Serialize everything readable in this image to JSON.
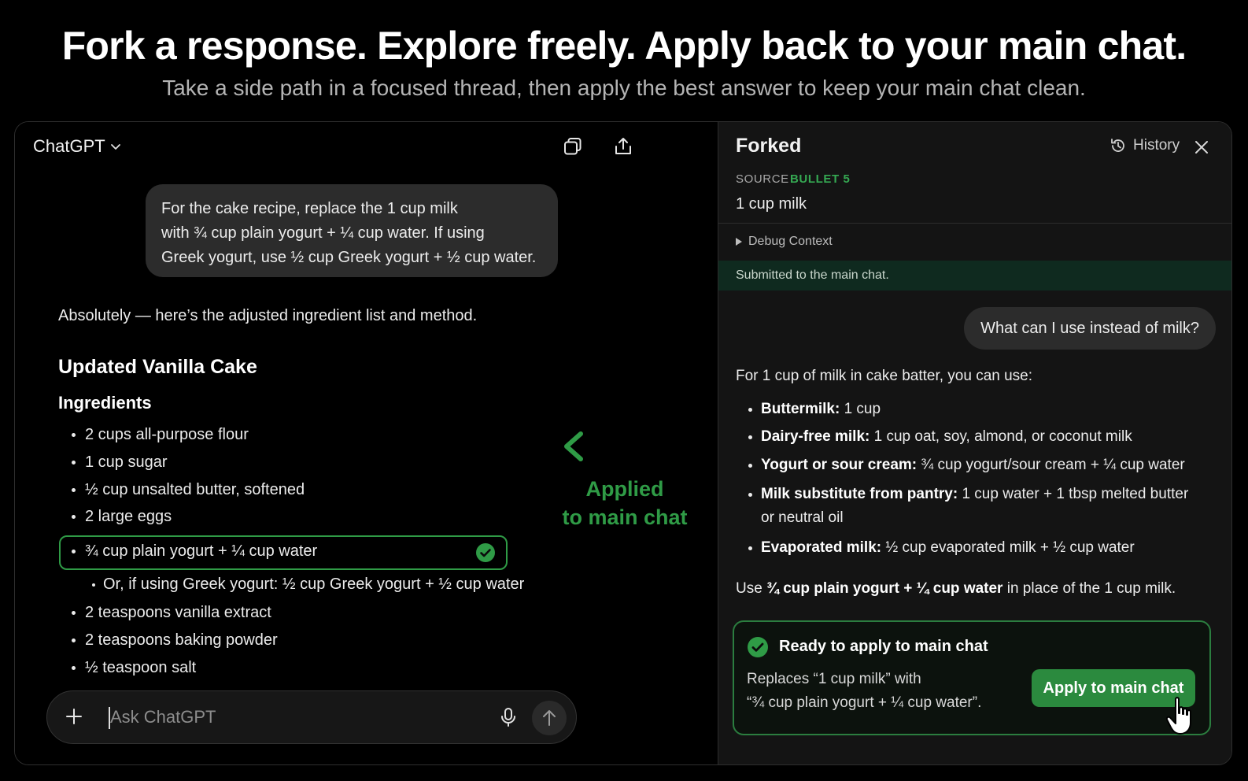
{
  "hero": {
    "title": "Fork a response. Explore freely.  Apply back to your main chat.",
    "subtitle": "Take a side path in a focused thread, then apply the best answer to keep your main chat clean."
  },
  "main_chat": {
    "model_name": "ChatGPT",
    "icons": [
      "copy-icon",
      "share-icon",
      "chevron-down-icon"
    ],
    "user_message": "For the cake recipe, replace the 1 cup milk with ¾ cup plain yogurt + ¼ cup water. If using Greek yogurt, use ½ cup Greek yogurt + ½ cup water.",
    "user_message_lines": [
      "For the cake recipe, replace the 1 cup milk",
      "with ¾ cup plain yogurt + ¼ cup water. If using",
      "Greek yogurt, use ½ cup Greek yogurt + ½ cup water."
    ],
    "assistant_intro": "Absolutely — here’s the adjusted ingredient list and method.",
    "recipe_title": "Updated Vanilla Cake",
    "ingredients_heading": "Ingredients",
    "ingredients": [
      "2 cups all-purpose flour",
      "1 cup sugar",
      "½ cup unsalted butter, softened",
      "2 large eggs",
      "¾ cup plain yogurt + ¼ cup water",
      "Or, if using Greek yogurt: ½ cup Greek yogurt + ½ cup water",
      "2 teaspoons vanilla extract",
      "2 teaspoons baking powder",
      "½ teaspoon salt"
    ],
    "highlighted_ingredient_index": 4,
    "applied_label_line1": "Applied",
    "applied_label_line2": "to main chat",
    "composer_placeholder": "Ask ChatGPT",
    "accent_green": "#2f9b46"
  },
  "fork_panel": {
    "title": "Forked",
    "history_label": "History",
    "source_label": "SOURCE",
    "source_tag": "BULLET 5",
    "source_value": "1 cup milk",
    "debug_label": "Debug Context",
    "submitted_notice": "Submitted to the main chat.",
    "question": "What can I use instead of milk?",
    "answer_lead": "For 1 cup of milk in cake batter, you can use:",
    "options": [
      {
        "name": "Buttermilk:",
        "detail": " 1 cup"
      },
      {
        "name": "Dairy-free milk:",
        "detail": " 1 cup oat, soy, almond, or coconut milk"
      },
      {
        "name": "Yogurt or sour cream:",
        "detail": " ¾ cup yogurt/sour cream + ¼ cup water"
      },
      {
        "name": "Milk substitute from pantry:",
        "detail": " 1 cup water + 1 tbsp melted butter or neutral oil"
      },
      {
        "name": "Evaporated milk:",
        "detail": " ½ cup evaporated milk + ½ cup water"
      }
    ],
    "use_prefix": "Use ",
    "use_bold": "¾ cup plain yogurt + ¼ cup water",
    "use_suffix": " in place of the 1 cup milk.",
    "ready_title": "Ready to apply to main chat",
    "ready_desc_line1": "Replaces “1 cup milk” with",
    "ready_desc_line2": "“¾ cup plain yogurt + ¼ cup water”.",
    "apply_button": "Apply to main chat"
  }
}
